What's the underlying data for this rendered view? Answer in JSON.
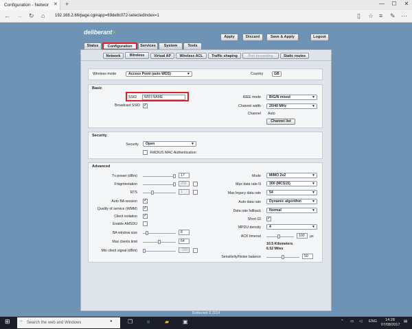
{
  "browser": {
    "tab_title": "Configuration - Networ",
    "url": "192.168.2.66/page.cgi#app=69de8c072-selectedIndex=1"
  },
  "brand": {
    "name": "deliberant",
    "accent": "#8cc63f",
    "highlight": "#e01e25"
  },
  "header_buttons": [
    "Apply",
    "Discard",
    "Save & Apply",
    "Logout"
  ],
  "main_tabs": [
    "Status",
    "Configuration",
    "Services",
    "System",
    "Tools"
  ],
  "active_main_tab": "Configuration",
  "sub_tabs": [
    "Network",
    "Wireless",
    "Virtual AP",
    "Wireless ACL",
    "Traffic shaping",
    "Port forwarding",
    "Static routes"
  ],
  "active_sub_tab": "Wireless",
  "wireless_mode": {
    "label": "Wireless mode",
    "value": "Access Point (auto WDS)"
  },
  "country": {
    "label": "Country",
    "value": "GB"
  },
  "basic": {
    "title": "Basic",
    "ssid_label": "SSID",
    "ssid_value": "WIFI NAME",
    "broadcast_label": "Broadcast SSID",
    "ieee_label": "IEEE mode",
    "ieee_value": "B/G/N mixed",
    "width_label": "Channel width",
    "width_value": "20/40 MHz",
    "channel_label": "Channel",
    "channel_value": "Auto",
    "channel_list_button": "Channel list"
  },
  "security": {
    "title": "Security",
    "label": "Security",
    "value": "Open",
    "radius_label": "RADIUS MAC Authentication"
  },
  "advanced": {
    "title": "Advanced",
    "tx_power": {
      "label": "Tx power (dBm)",
      "value": "17"
    },
    "fragmentation": {
      "label": "Fragmentation",
      "value": "256"
    },
    "rts": {
      "label": "RTS",
      "value": "1"
    },
    "auto_ba": {
      "label": "Auto BA session"
    },
    "wmm": {
      "label": "Quality of service (WMM)"
    },
    "client_isolation": {
      "label": "Client isolation"
    },
    "amsdu": {
      "label": "Enable AMSDU"
    },
    "ba_window": {
      "label": "BA window size",
      "value": "8"
    },
    "max_clients": {
      "label": "Max clients limit",
      "value": "64"
    },
    "min_signal": {
      "label": "Min client signal (dBm)",
      "value": "-100"
    },
    "mode": {
      "label": "Mode",
      "value": "MIMO 2x2"
    },
    "max_rate_n": {
      "label": "Max data rate N",
      "value": "300 (MCS15)"
    },
    "max_legacy": {
      "label": "Max legacy data rate",
      "value": "54"
    },
    "auto_rate": {
      "label": "Auto data rate",
      "value": "Dynamic algorithm"
    },
    "rate_fallback": {
      "label": "Data rate fallback",
      "value": "Normal"
    },
    "short_gi": {
      "label": "Short GI"
    },
    "mpdu": {
      "label": "MPDU density",
      "value": "4"
    },
    "ack": {
      "label": "ACK timeout",
      "value": "100",
      "unit": "µs",
      "km": "10.5 Kilometers",
      "miles": "6.52 Miles"
    },
    "sensitivity": {
      "label": "Sensitivity/Noise balance",
      "value": "50"
    }
  },
  "footer": "Deliberant © 2014",
  "taskbar": {
    "search_placeholder": "Search the web and Windows",
    "lang": "ENG",
    "time": "14:28",
    "date": "07/08/2017"
  }
}
